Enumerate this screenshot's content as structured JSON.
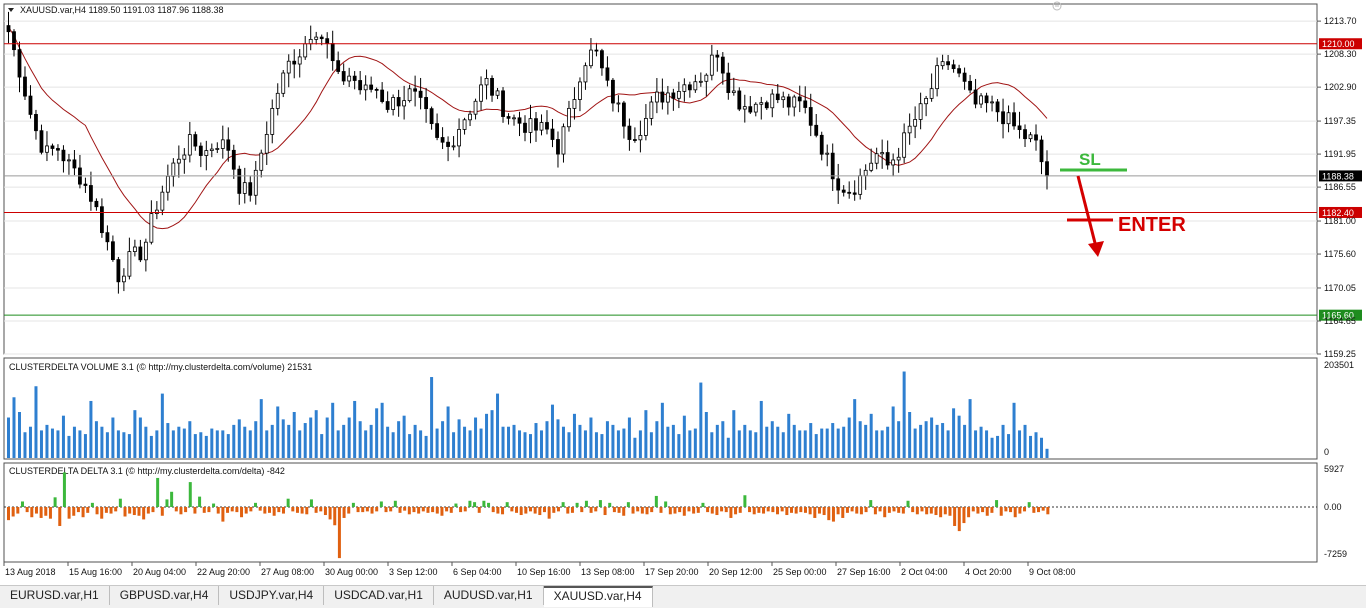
{
  "header": {
    "symbol_line": "XAUUSD.var,H4  1189.50 1191.03 1187.96 1188.38"
  },
  "chart_data": [
    {
      "type": "candlestick",
      "title": "XAUUSD.var,H4",
      "ohlc_last": {
        "open": 1189.5,
        "high": 1191.03,
        "low": 1187.96,
        "close": 1188.38
      },
      "ylim": [
        1159.25,
        1216.5
      ],
      "y_ticks": [
        "1213.70",
        "1208.30",
        "1202.90",
        "1197.35",
        "1191.95",
        "1186.55",
        "1181.00",
        "1175.60",
        "1170.05",
        "1164.65",
        "1159.25"
      ],
      "x_ticks": [
        "13 Aug 2018",
        "15 Aug 16:00",
        "20 Aug 04:00",
        "22 Aug 20:00",
        "27 Aug 08:00",
        "30 Aug 00:00",
        "3 Sep 12:00",
        "6 Sep 04:00",
        "10 Sep 16:00",
        "13 Sep 08:00",
        "17 Sep 20:00",
        "20 Sep 12:00",
        "25 Sep 00:00",
        "27 Sep 16:00",
        "2 Oct 04:00",
        "4 Oct 20:00",
        "9 Oct 08:00"
      ],
      "price_path": [
        1212,
        1205,
        1197,
        1192,
        1193,
        1190,
        1188,
        1184,
        1178,
        1172,
        1175,
        1176,
        1183,
        1188,
        1192,
        1194,
        1192,
        1194,
        1193,
        1186,
        1186,
        1195,
        1202,
        1207,
        1209,
        1213,
        1210,
        1204,
        1205,
        1202,
        1203,
        1200,
        1201,
        1202,
        1199,
        1194,
        1193,
        1197,
        1200,
        1204,
        1201,
        1198,
        1197,
        1196,
        1196,
        1193,
        1199,
        1207,
        1209,
        1203,
        1199,
        1195,
        1197,
        1201,
        1202,
        1203,
        1204,
        1205,
        1209,
        1203,
        1200,
        1200,
        1201,
        1201,
        1200,
        1200,
        1196,
        1191,
        1187,
        1186,
        1189,
        1192,
        1190,
        1193,
        1197,
        1200,
        1205,
        1207,
        1204,
        1200,
        1200,
        1199,
        1197,
        1195,
        1194,
        1188
      ],
      "horizontal_levels": [
        {
          "label": "1210.00",
          "color": "#cc0000"
        },
        {
          "label": "1188.38",
          "color": "#9a9a9a"
        },
        {
          "label": "1182.40",
          "color": "#cc0000"
        },
        {
          "label": "1165.60",
          "color": "#1e8c1e"
        }
      ],
      "annotations": [
        {
          "text": "SL",
          "color": "#3cb83c"
        },
        {
          "text": "ENTER",
          "color": "#d40000"
        }
      ]
    },
    {
      "type": "bar",
      "title": "CLUSTERDELTA VOLUME 3.1 (© http://my.clusterdelta.com/volume) 21531",
      "ylim": [
        0,
        203501
      ],
      "y_ticks": [
        "203501",
        "0"
      ],
      "color": "#2e7fd0",
      "values": [
        44,
        66,
        50,
        28,
        34,
        78,
        30,
        36,
        32,
        30,
        46,
        24,
        34,
        30,
        26,
        62,
        40,
        34,
        28,
        44,
        30,
        28,
        26,
        52,
        44,
        34,
        24,
        30,
        70,
        38,
        30,
        34,
        32,
        40,
        26,
        28,
        24,
        32,
        30,
        30,
        26,
        36,
        42,
        34,
        30,
        40,
        64,
        30,
        36,
        56,
        42,
        36,
        50,
        30,
        38,
        44,
        52,
        26,
        44,
        60,
        30,
        36,
        44,
        62,
        40,
        30,
        36,
        54,
        60,
        34,
        28,
        40,
        46,
        26,
        36,
        30,
        24,
        88,
        32,
        40,
        56,
        28,
        42,
        34,
        30,
        44,
        32,
        48,
        52,
        70,
        34,
        34,
        36,
        30,
        28,
        26,
        38,
        30,
        40,
        58,
        42,
        34,
        28,
        48,
        36,
        30,
        44,
        28,
        26,
        40,
        36,
        30,
        32,
        44,
        22,
        30,
        52,
        28,
        40,
        60,
        34,
        36,
        26,
        46,
        30,
        32,
        82,
        50,
        28,
        36,
        40,
        22,
        52,
        30,
        36,
        30,
        28,
        62,
        34,
        40,
        34,
        28,
        48,
        36,
        30,
        30,
        38,
        26,
        32,
        32,
        38,
        32,
        34,
        44,
        64,
        40,
        36,
        48,
        30,
        30,
        34,
        56,
        40,
        94,
        50,
        32,
        36,
        40,
        44,
        36,
        38,
        30,
        54,
        46,
        36,
        64,
        30,
        34,
        30,
        22,
        24,
        36,
        26,
        60,
        30,
        36,
        24,
        28,
        22,
        10
      ]
    },
    {
      "type": "bar",
      "title": "CLUSTERDELTA DELTA 3.1 (© http://my.clusterdelta.com/delta) -842",
      "ylim": [
        -7259,
        5927
      ],
      "y_ticks": [
        "5927",
        "0.00",
        "-7259"
      ],
      "positive_color": "#3cb83c",
      "negative_color": "#e06010",
      "values": [
        -1800,
        -1300,
        -900,
        800,
        -700,
        -1400,
        -900,
        -1500,
        -1200,
        -1600,
        1400,
        -2600,
        5000,
        -1600,
        -1200,
        -700,
        -1400,
        -800,
        600,
        -1000,
        -1600,
        -800,
        -900,
        -600,
        1200,
        -1300,
        -900,
        -1100,
        -1200,
        -1700,
        -900,
        -700,
        4200,
        -1200,
        1100,
        2200,
        -600,
        -1000,
        -700,
        3600,
        -900,
        1500,
        -800,
        -700,
        500,
        -900,
        -2000,
        -800,
        -600,
        -700,
        -1400,
        -900,
        -600,
        600,
        -500,
        -900,
        -800,
        -1200,
        -700,
        -900,
        1200,
        -600,
        -800,
        -900,
        -1000,
        1100,
        -800,
        -600,
        -1100,
        -1700,
        -2500,
        -7000,
        -1500,
        -900,
        600,
        -700,
        -700,
        -600,
        -900,
        -600,
        800,
        -700,
        -600,
        900,
        -800,
        -500,
        -1000,
        -700,
        -900,
        -600,
        -800,
        -700,
        -900,
        -1200,
        -600,
        -800,
        500,
        -700,
        -600,
        900,
        700,
        -800,
        900,
        600,
        -700,
        -900,
        -1000,
        700,
        -600,
        -800,
        -1100,
        -900,
        -600,
        -900,
        -1100,
        -700,
        -1600,
        -800,
        -600,
        700,
        -900,
        -800,
        600,
        -700,
        900,
        -800,
        -600,
        1000,
        -1100,
        600,
        -700,
        -800,
        -1200,
        700,
        -900,
        -600,
        -900,
        -1000,
        -700,
        1600,
        -800,
        800,
        -1000,
        -900,
        -700,
        -1200,
        -600,
        -900,
        -800,
        600,
        -700,
        -900,
        -1100,
        -600,
        -700,
        -1500,
        -1000,
        -800,
        1700,
        -700,
        -1000,
        -800,
        -900,
        -600,
        -700,
        -1000,
        -600,
        -1100,
        -800,
        -900,
        -700,
        -800,
        -1000,
        -1500,
        -900,
        -1100,
        -1800,
        -2000,
        -1000,
        -1500,
        -800,
        -600,
        -900,
        -1000,
        -700,
        1000,
        -1000,
        -600,
        -1400,
        -800,
        -600,
        -800,
        -900,
        900,
        -700,
        -1000,
        -600,
        -1000,
        -900,
        -1100,
        -1400,
        -1000,
        -1200,
        -2600,
        -3300,
        -2200,
        -1400,
        -600,
        -900,
        -700,
        -1200,
        -800,
        1000,
        -1200,
        -600,
        -700,
        -1400,
        -900,
        -600,
        700,
        -800,
        -700,
        -500,
        -1000
      ]
    }
  ],
  "tabs": [
    {
      "label": "EURUSD.var,H1",
      "active": false
    },
    {
      "label": "GBPUSD.var,H4",
      "active": false
    },
    {
      "label": "USDJPY.var,H4",
      "active": false
    },
    {
      "label": "USDCAD.var,H1",
      "active": false
    },
    {
      "label": "AUDUSD.var,H1",
      "active": false
    },
    {
      "label": "XAUUSD.var,H4",
      "active": true
    }
  ]
}
